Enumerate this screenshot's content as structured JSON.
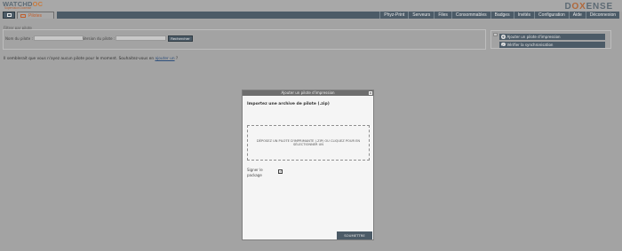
{
  "header": {
    "logo_main_a": "WATCHD",
    "logo_main_b": "OC",
    "logo_sub": "Supervision Doxense",
    "brand_a": "D",
    "brand_b": "OX",
    "brand_c": "ENSE"
  },
  "tabs": {
    "active_label": "Pilotes"
  },
  "menu": {
    "items": [
      "Phyz-Print",
      "Serveurs",
      "Files",
      "Consommables",
      "Badges",
      "Invités",
      "Configuration",
      "Aide",
      "Déconnexion"
    ]
  },
  "filter": {
    "legend": "Filtrer par pilote",
    "name_label": "Nom du pilote :",
    "name_value": "",
    "version_label": "Version du pilote :",
    "version_value": "",
    "search_button": "Rechercher"
  },
  "actions": {
    "add_label": "Ajouter un pilote d'impression",
    "check_label": "Vérifier la synchronisation"
  },
  "message": {
    "text": "Il semblerait que vous n'ayez aucun pilote pour le moment. Souhaitez-vous en",
    "link": "ajouter un",
    "suffix": " ?"
  },
  "modal": {
    "title": "Ajouter un pilote d'impression",
    "close": "x",
    "heading": "Importez une archive de pilote (.zip)",
    "dropzone_line1": "DÉPOSEZ UN PILOTE D'IMPRIMANTE (.ZIP) OU CLIQUEZ POUR EN",
    "dropzone_line2": "SÉLECTIONNER UN",
    "sign_label_line1": "Signer le",
    "sign_label_line2": "package",
    "sign_checked": "✓",
    "submit": "SOUMETTRE"
  }
}
